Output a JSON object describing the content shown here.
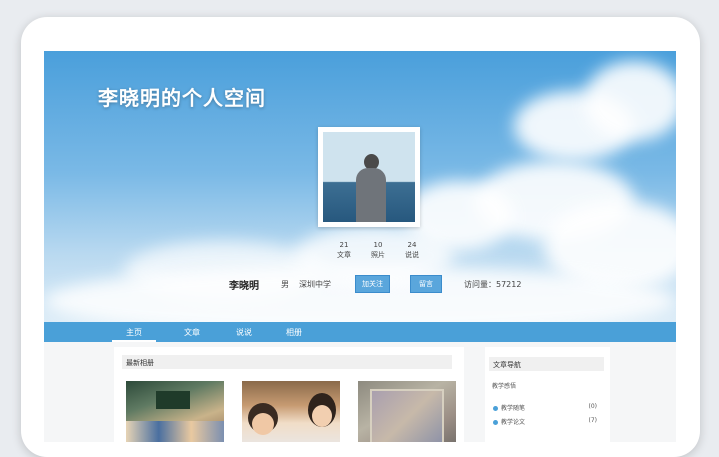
{
  "site": {
    "title": "李晓明的个人空间"
  },
  "stats": [
    {
      "count": "21",
      "label": "文章"
    },
    {
      "count": "10",
      "label": "照片"
    },
    {
      "count": "24",
      "label": "说说"
    }
  ],
  "profile": {
    "name": "李晓明",
    "gender": "男",
    "school": "深圳中学",
    "follow_label": "加关注",
    "message_label": "留言",
    "visits": "访问量：57212"
  },
  "nav": {
    "items": [
      "主页",
      "文章",
      "说说",
      "相册"
    ],
    "active": "主页"
  },
  "albums": {
    "title": "最新相册"
  },
  "article_nav": {
    "title": "文章导航",
    "category": "教学感悟",
    "items": [
      {
        "label": "教学随笔",
        "count": "(0)"
      },
      {
        "label": "教学论文",
        "count": "(7)"
      }
    ]
  },
  "colors": {
    "accent": "#4aa0d8",
    "sky": "#4a9fdb"
  }
}
